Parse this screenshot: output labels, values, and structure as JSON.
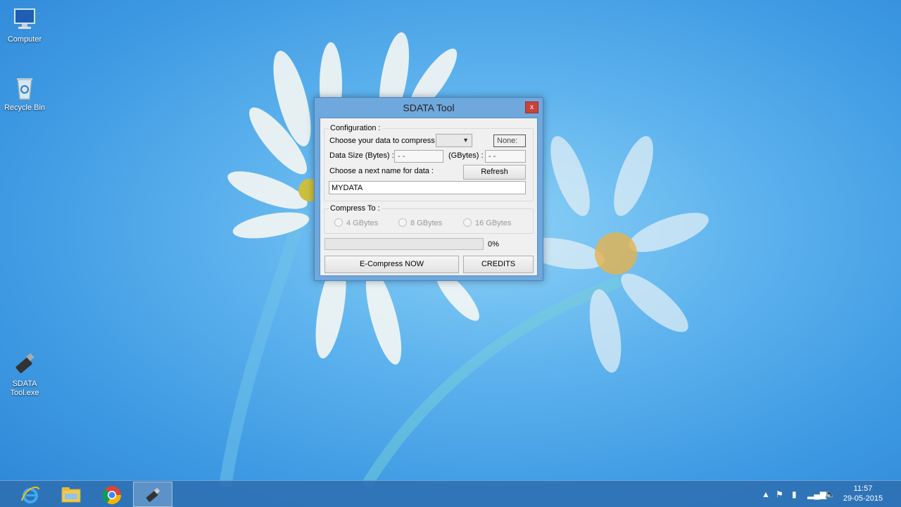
{
  "desktop": {
    "icons": [
      {
        "label": "Computer",
        "icon": "computer-icon"
      },
      {
        "label": "Recycle Bin",
        "icon": "recycle-bin-icon"
      },
      {
        "label_line1": "SDATA",
        "label_line2": "Tool.exe",
        "icon": "usb-drive-icon"
      }
    ]
  },
  "window": {
    "title": "SDATA Tool",
    "close_label": "x",
    "configuration": {
      "legend": "Configuration :",
      "choose_label": "Choose your data to compress :",
      "choose_selected": "",
      "none_label": "None:",
      "data_size_label": "Data Size (Bytes) :",
      "data_size_bytes": "- -",
      "gbytes_label": "(GBytes) :",
      "data_size_gbytes": "- -",
      "next_name_label": "Choose a next name for data :",
      "refresh_label": "Refresh",
      "name_value": "MYDATA"
    },
    "compress_to": {
      "legend": "Compress To :",
      "options": [
        "4 GBytes",
        "8 GBytes",
        "16 GBytes"
      ]
    },
    "progress": {
      "value": 0,
      "text": "0%"
    },
    "compress_button": "E-Compress NOW",
    "credits_button": "CREDITS"
  },
  "taskbar": {
    "apps": [
      "internet-explorer-icon",
      "file-explorer-icon",
      "chrome-icon",
      "sdata-tool-icon"
    ],
    "active_app": "sdata-tool-icon",
    "clock": {
      "time": "11:57",
      "date": "29-05-2015"
    }
  },
  "colors": {
    "accent": "#6fa8dc",
    "close": "#c7433a",
    "taskbar": "#2e6eb0"
  }
}
